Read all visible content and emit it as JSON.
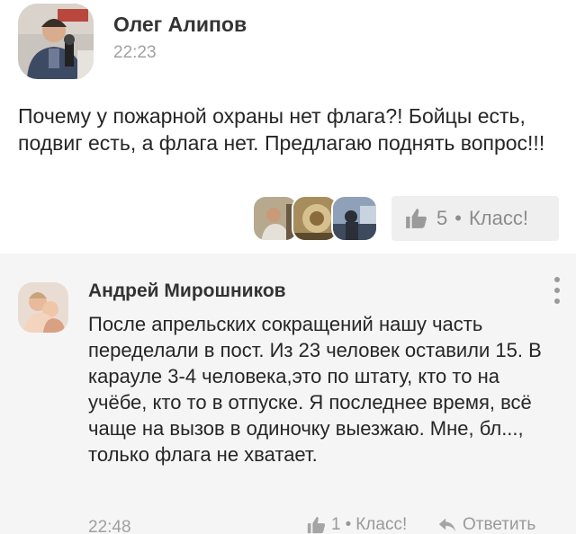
{
  "post": {
    "author": "Олег Алипов",
    "time": "22:23",
    "text": "Почему у пожарной охраны нет флага?! Бойцы есть, подвиг есть, а флага нет. Предлагаю поднять вопрос!!!",
    "likes": {
      "count": "5",
      "separator": "•",
      "label": "Класс!"
    },
    "likers_count": 3
  },
  "comment": {
    "author": "Андрей Мирошников",
    "text": "После апрельских сокращений нашу часть переделали в пост. Из 23 человек оставили 15. В карауле 3-4 человека,это по штату, кто то на учёбе, кто то в отпуске. Я последнее время, всё чаще на вызов в одиночку выезжаю. Мне, бл..., только флага не хватает.",
    "time": "22:48",
    "likes": {
      "count": "1",
      "separator": "•",
      "label": "Класс!"
    },
    "reply_label": "Ответить"
  },
  "colors": {
    "muted": "#a0a0a0",
    "button_bg": "#efefef",
    "comment_bg": "#f5f5f5"
  }
}
